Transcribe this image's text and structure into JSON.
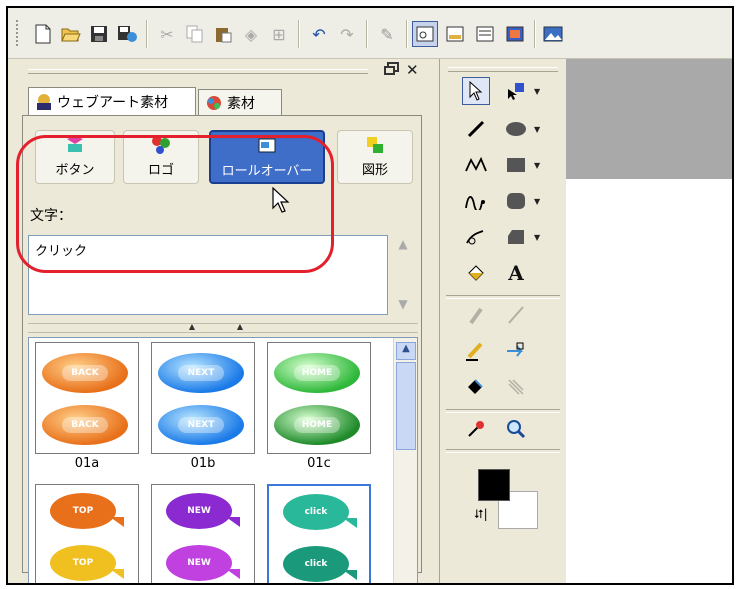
{
  "toolbar": {
    "buttons": [
      "new-icon",
      "open-icon",
      "save-icon",
      "publish-icon",
      "cut-icon",
      "copy-icon",
      "paste-icon",
      "erase-icon",
      "grid-icon",
      "undo-icon",
      "redo-icon",
      "edit-icon",
      "layout-a-icon",
      "layout-b-icon",
      "layout-c-icon",
      "layout-d-icon",
      "image-icon"
    ]
  },
  "panel": {
    "tabs": [
      {
        "label": "ウェブアート素材",
        "icon": "web-art-icon",
        "active": true
      },
      {
        "label": "素材",
        "icon": "material-icon",
        "active": false
      }
    ],
    "categories": [
      {
        "label": "ボタン",
        "icon": "button-category-icon",
        "selected": false
      },
      {
        "label": "ロゴ",
        "icon": "logo-category-icon",
        "selected": false
      },
      {
        "label": "ロールオーバー",
        "icon": "rollover-category-icon",
        "selected": true
      },
      {
        "label": "図形",
        "icon": "shape-category-icon",
        "selected": false
      }
    ],
    "text_label": "文字：",
    "text_value": "クリック",
    "thumbnails": [
      {
        "label": "01a",
        "style": "orange-pill",
        "top_text": "BACK",
        "bottom_text": "BACK"
      },
      {
        "label": "01b",
        "style": "blue-pill",
        "top_text": "NEXT",
        "bottom_text": "NEXT"
      },
      {
        "label": "01c",
        "style": "green-pill",
        "top_text": "HOME",
        "bottom_text": "HOME"
      },
      {
        "label": "",
        "style": "orange-bubble",
        "top_text": "TOP",
        "bottom_text": "TOP"
      },
      {
        "label": "",
        "style": "purple-bubble",
        "top_text": "NEW",
        "bottom_text": "NEW"
      },
      {
        "label": "",
        "style": "teal-bubble",
        "top_text": "click",
        "bottom_text": "click",
        "selected": true
      }
    ]
  },
  "colors": {
    "accent": "#3f6ec8",
    "highlight_ring": "#e4202c",
    "foreground": "#000000",
    "background": "#ffffff"
  },
  "tools": [
    "pointer-icon",
    "subselect-icon",
    "line-icon",
    "ellipse-icon",
    "polyline-icon",
    "rectangle-icon",
    "curve-icon",
    "rounded-rect-icon",
    "pen-icon",
    "polygon-icon",
    "fill-bucket-icon",
    "text-tool-icon",
    "eraser-icon",
    "knife-icon",
    "brush-icon",
    "transform-icon",
    "paint-icon",
    "gradient-icon",
    "eyedropper-icon",
    "zoom-icon"
  ]
}
